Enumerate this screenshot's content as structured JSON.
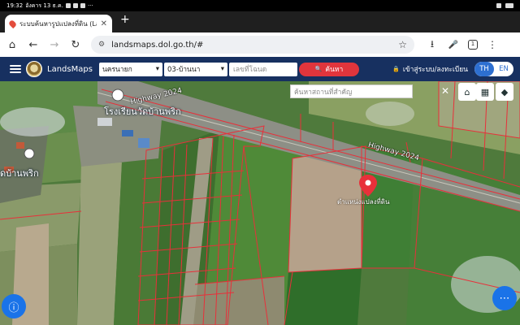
{
  "status": {
    "time": "19:32",
    "date": "อังคาร 13 ธ.ค.",
    "more": "···"
  },
  "browser": {
    "tab_title": "ระบบค้นหารูปแปลงที่ดิน (Lan",
    "tab_close": "✕",
    "new_tab": "+",
    "url": "landsmaps.dol.go.th/#",
    "tab_count": "1"
  },
  "icons": {
    "home": "⌂",
    "back": "←",
    "forward": "→",
    "reload": "↻",
    "secure": "⚙",
    "star": "☆",
    "download": "⭳",
    "mic": "🎤",
    "menu": "⋮",
    "search": "🔍",
    "lock": "🔒",
    "close": "✕",
    "layers": "◆",
    "grid": "▦",
    "house": "⌂",
    "chevron": "▾",
    "more": "⋯",
    "info": "ⓘ"
  },
  "app": {
    "brand": "LandsMaps",
    "province": "นครนายก",
    "district": "03-บ้านนา",
    "deed_placeholder": "เลขที่โฉนด",
    "search_label": "ค้นหา",
    "login_label": "เข้าสู่ระบบ/ลงทะเบียน",
    "lang_th": "TH",
    "lang_en": "EN"
  },
  "map": {
    "search_placeholder": "ค้นหาสถานที่สำคัญ",
    "highway_1": "Highway 2024",
    "highway_2": "Highway 2024",
    "school_label": "โรงเรียนวัดบ้านพริก",
    "village_label": "ดบ้านพริก",
    "parcel_label": "ตำแหน่งแปลงที่ดิน",
    "pin_color": "#e8303a",
    "parcel_line_color": "#e8303a"
  }
}
